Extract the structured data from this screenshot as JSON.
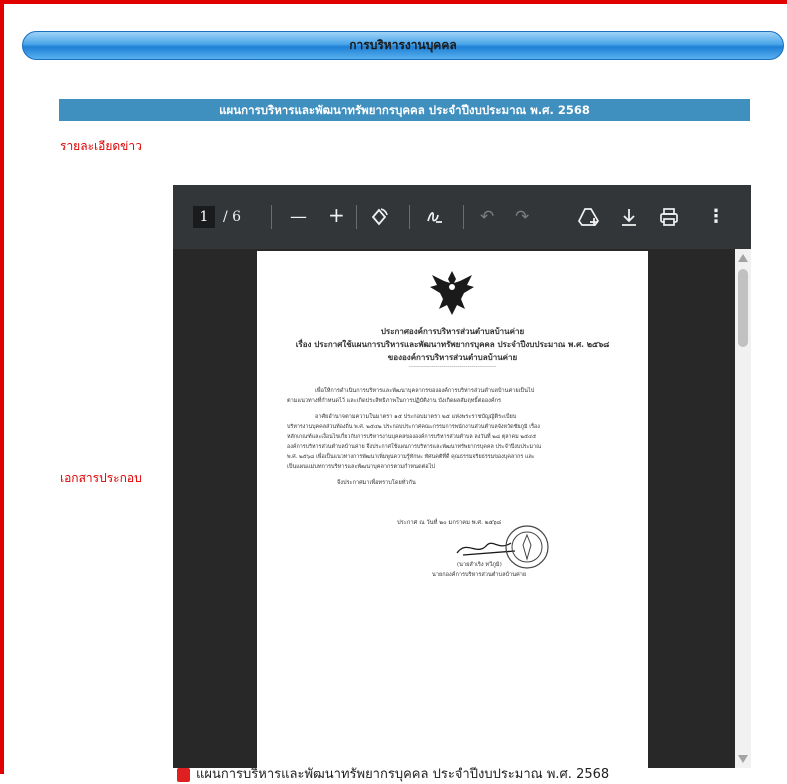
{
  "section_bar": {
    "title": "การบริหารงานบุคคล"
  },
  "news_title": "แผนการบริหารและพัฒนาทรัพยากรบุคคล ประจำปีงบประมาณ พ.ศ. 2568",
  "labels": {
    "details": "รายละเอียดข่าว",
    "attachments": "เอกสารประกอบ"
  },
  "pdf_viewer": {
    "current_page": "1",
    "total_pages": "/ 6",
    "toolbar_icons": [
      "zoom-out-icon",
      "zoom-in-icon",
      "rotate-icon",
      "annotate-icon",
      "undo-icon",
      "redo-icon",
      "add-drive-icon",
      "download-icon",
      "print-icon",
      "more-menu-icon"
    ],
    "document": {
      "heading1": "ประกาศองค์การบริหารส่วนตำบลบ้านค่าย",
      "heading2": "เรื่อง ประกาศใช้แผนการบริหารและพัฒนาทรัพยากรบุคคล ประจำปีงบประมาณ พ.ศ. ๒๕๖๘",
      "heading3": "ขององค์การบริหารส่วนตำบลบ้านค่าย",
      "divider": "-------------------------------------------",
      "para1_line1": "เพื่อให้การดำเนินการบริหารและพัฒนาบุคลากรขององค์การบริหารส่วนตำบลบ้านค่ายเป็นไป",
      "para1_line2": "ตามแนวทางที่กำหนดไว้ และเกิดประสิทธิภาพในการปฏิบัติงาน บังเกิดผลสัมฤทธิ์ต่อองค์กร",
      "para2_line1": "อาศัยอำนาจตามความในมาตรา ๑๕ ประกอบมาตรา ๒๕ แห่งพระราชบัญญัติระเบียบ",
      "para2_line2": "บริหารงานบุคคลส่วนท้องถิ่น พ.ศ. ๒๕๔๒ ประกอบประกาศคณะกรรมการพนักงานส่วนตำบลจังหวัดชัยภูมิ เรื่อง",
      "para2_line3": "หลักเกณฑ์และเงื่อนไขเกี่ยวกับการบริหารงานบุคคลขององค์การบริหารส่วนตำบล ลงวันที่ ๒๘ ตุลาคม ๒๕๔๕",
      "para2_line4": "องค์การบริหารส่วนตำบลบ้านค่าย จึงประกาศใช้แผนการบริหารและพัฒนาทรัพยากรบุคคล ประจำปีงบประมาณ",
      "para2_line5": "พ.ศ. ๒๕๖๘ เพื่อเป็นแนวทางการพัฒนาเพิ่มพูนความรู้ทักษะ ทัศนคติที่ดี คุณธรรมจริยธรรมของบุคลากร และ",
      "para2_line6": "เป็นแผนแม่บทการบริหารและพัฒนาบุคลากรตามกำหนดต่อไป",
      "announce": "จึงประกาศมาเพื่อทราบโดยทั่วกัน",
      "date_line": "ประกาศ ณ วันที่   ๒๐  มกราคม  พ.ศ. ๒๕๖๘",
      "signer_name": "(นายสำเริง  ทวีภูมิ)",
      "signer_title": "นายกองค์การบริหารส่วนตำบลบ้านค่าย"
    }
  },
  "attachment": {
    "filename": "แผนการบริหารและพัฒนาทรัพยากรบุคคล ประจำปีงบประมาณ พ.ศ. 2568"
  }
}
